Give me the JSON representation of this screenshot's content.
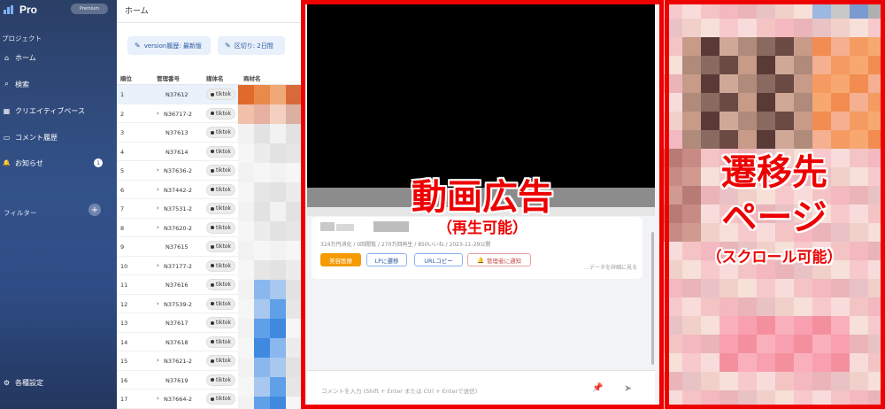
{
  "sidebar": {
    "app_name": "Pro",
    "plan_badge": "Premium",
    "section_project": "プロジェクト",
    "nav": [
      {
        "icon": "home-icon",
        "glyph": "⌂",
        "label": "ホーム"
      },
      {
        "icon": "search-icon",
        "glyph": "⌕",
        "label": "検索"
      },
      {
        "icon": "grid-icon",
        "glyph": "▦",
        "label": "クリエイティブベース"
      },
      {
        "icon": "comment-icon",
        "glyph": "▭",
        "label": "コメント履歴"
      },
      {
        "icon": "bell-icon",
        "glyph": "🔔",
        "label": "お知らせ",
        "count": "1"
      }
    ],
    "section_filter": "フィルター",
    "filter_add": "+",
    "settings": {
      "icon": "gear-icon",
      "glyph": "⚙",
      "label": "各種設定"
    }
  },
  "main": {
    "title": "ホーム",
    "chips": [
      {
        "label": "version履歴: 最新版"
      },
      {
        "label": "区切り: 2日間"
      }
    ],
    "columns": [
      "順位",
      "管理番号",
      "媒体名",
      "商材名"
    ],
    "rows": [
      {
        "rank": "1",
        "id": "N37612",
        "child": false,
        "media": "tiktok",
        "selected": true
      },
      {
        "rank": "2",
        "id": "N36717-2",
        "child": true,
        "media": "tiktok"
      },
      {
        "rank": "3",
        "id": "N37613",
        "child": false,
        "media": "tiktok"
      },
      {
        "rank": "4",
        "id": "N37614",
        "child": false,
        "media": "tiktok"
      },
      {
        "rank": "5",
        "id": "N37636-2",
        "child": true,
        "media": "tiktok"
      },
      {
        "rank": "6",
        "id": "N37442-2",
        "child": true,
        "media": "tiktok"
      },
      {
        "rank": "7",
        "id": "N37531-2",
        "child": true,
        "media": "tiktok"
      },
      {
        "rank": "8",
        "id": "N37620-2",
        "child": true,
        "media": "tiktok"
      },
      {
        "rank": "9",
        "id": "N37615",
        "child": false,
        "media": "tiktok"
      },
      {
        "rank": "10",
        "id": "N37177-2",
        "child": true,
        "media": "tiktok"
      },
      {
        "rank": "11",
        "id": "N37616",
        "child": false,
        "media": "tiktok"
      },
      {
        "rank": "12",
        "id": "N37539-2",
        "child": true,
        "media": "tiktok"
      },
      {
        "rank": "13",
        "id": "N37617",
        "child": false,
        "media": "tiktok"
      },
      {
        "rank": "14",
        "id": "N37618",
        "child": false,
        "media": "tiktok"
      },
      {
        "rank": "15",
        "id": "N37621-2",
        "child": true,
        "media": "tiktok"
      },
      {
        "rank": "16",
        "id": "N37619",
        "child": false,
        "media": "tiktok"
      },
      {
        "rank": "17",
        "id": "N37664-2",
        "child": true,
        "media": "tiktok"
      }
    ]
  },
  "video_panel": {
    "stats": "324万円消化 / 0回閲覧 / 270万回再生 / 850いいね / 2023-11-29公開",
    "buttons": {
      "beauty": "美容医療",
      "lp": "LPに遷移",
      "url_copy": "URLコピー",
      "notify": "管理者に通知"
    },
    "detail_link": "…データを詳細に見る",
    "comment_placeholder": "コメントを入力 (Shift + Enter または Ctrl + Enterで送信)"
  },
  "annotations": {
    "video_title": "動画広告",
    "video_sub": "（再生可能）",
    "lp_title_1": "遷移先",
    "lp_title_2": "ページ",
    "lp_sub": "（スクロール可能）"
  },
  "colors": {
    "annotation_red": "#ee0000",
    "sidebar_blue": "#33528a",
    "accent_orange": "#f59a00"
  }
}
